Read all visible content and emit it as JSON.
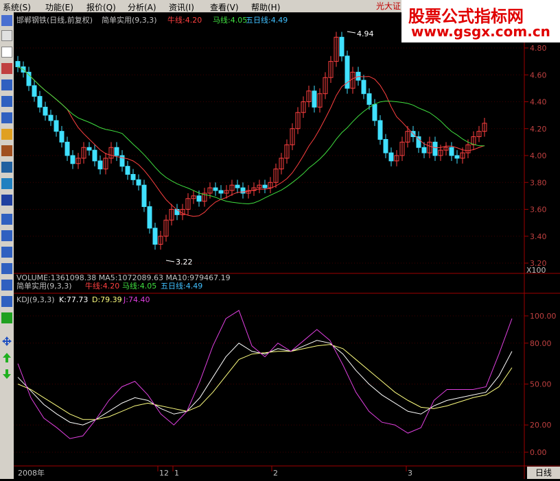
{
  "menu": {
    "items": [
      "系统(S)",
      "功能(E)",
      "报价(Q)",
      "分析(A)",
      "资讯(I)",
      "查看(V)",
      "帮助(H)"
    ],
    "brand": "光大证"
  },
  "watermark": {
    "line1": "股票公式指标网",
    "line2": "www.gsgx.com.cn"
  },
  "main": {
    "stock_title": "邯郸钢铁(日线,前复权)",
    "indicator_name": "简单实用(9,3,3)",
    "legend": [
      {
        "label": "牛线:4.20",
        "color": "#ff4040"
      },
      {
        "label": "马线:4.05",
        "color": "#40e040"
      },
      {
        "label": "五日线:4.49",
        "color": "#40c0ff"
      }
    ],
    "high_label": "4.94",
    "low_label": "3.22",
    "y_ticks": [
      "4.80",
      "4.60",
      "4.40",
      "4.20",
      "4.00",
      "3.80",
      "3.60",
      "3.40",
      "3.20"
    ],
    "multiplier_label": "X100"
  },
  "volume": {
    "text": "VOLUME:1361098.38  MA5:1072089.63  MA10:979467.19"
  },
  "sub1": {
    "indicator_name": "简单实用(9,3,3)",
    "legend": [
      {
        "label": "牛线:4.20",
        "color": "#ff4040"
      },
      {
        "label": "马线:4.05",
        "color": "#40e040"
      },
      {
        "label": "五日线:4.49",
        "color": "#40c0ff"
      }
    ]
  },
  "kdj": {
    "title": "KDJ(9,3,3)",
    "k_label": "K:77.73",
    "d_label": "D:79.39",
    "j_label": "J:74.40",
    "y_ticks": [
      "100.00",
      "80.00",
      "50.00",
      "20.00",
      "0.00"
    ],
    "colors": {
      "k": "#ffffff",
      "d": "#ffff80",
      "j": "#e040e0"
    }
  },
  "time_axis": {
    "labels": [
      "2008年",
      "12",
      "1",
      "2",
      "3"
    ]
  },
  "bottom_tab": "日线"
}
